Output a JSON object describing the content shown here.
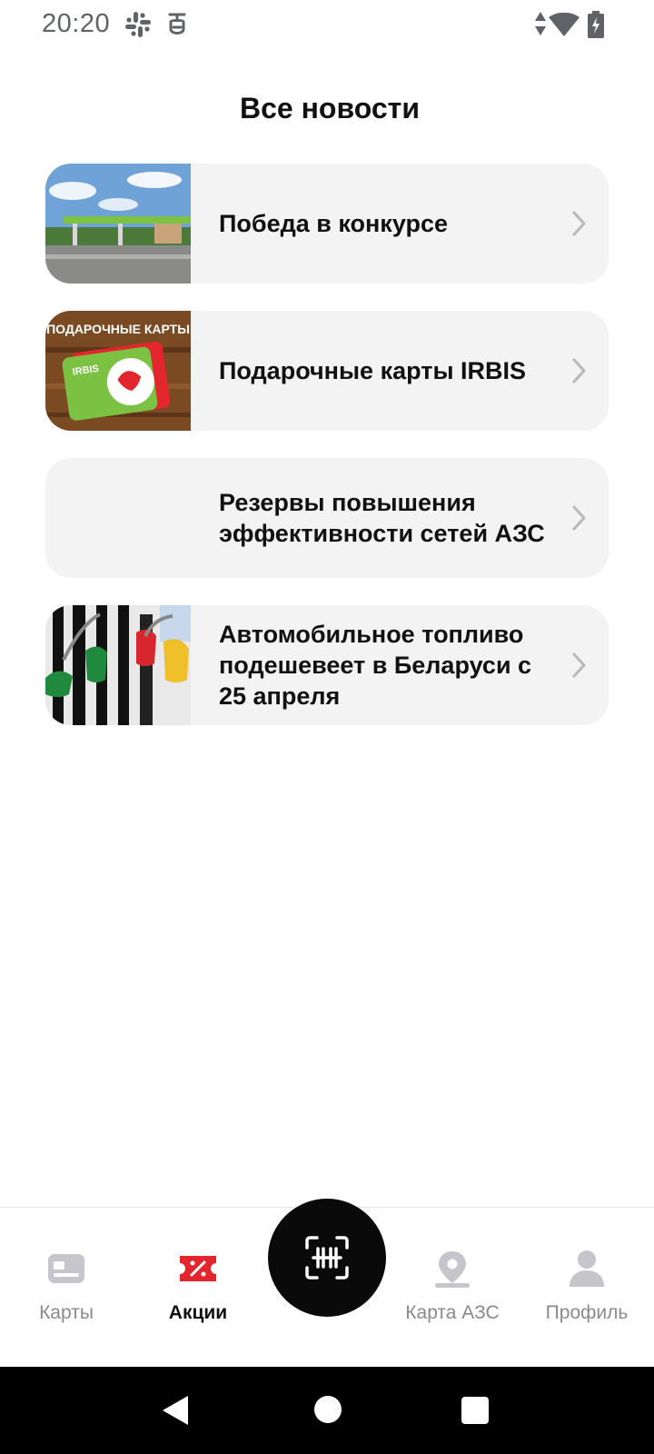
{
  "status_bar": {
    "time": "20:20",
    "icons": [
      "slack-icon",
      "notification-icon",
      "mobile-data-icon",
      "wifi-icon",
      "battery-charging-icon"
    ]
  },
  "header": {
    "title": "Все новости"
  },
  "news": [
    {
      "title": "Победа в конкурсе",
      "thumbnail": "gas-station-photo"
    },
    {
      "title": "Подарочные карты IRBIS",
      "thumbnail": "gift-cards-photo",
      "thumbnail_caption": "ПОДАРОЧНЫЕ КАРТЫ",
      "card_brand": "IRBIS"
    },
    {
      "title": "Резервы повышения эффективности сетей АЗС",
      "thumbnail": ""
    },
    {
      "title": "Автомобильное топливо подешевеет в Беларуси с 25 апреля",
      "thumbnail": "fuel-nozzles-photo"
    }
  ],
  "bottom_nav": {
    "items": [
      {
        "label": "Карты",
        "icon": "cards-icon",
        "active": false
      },
      {
        "label": "Акции",
        "icon": "promo-percent-icon",
        "active": true
      },
      {
        "label": "Карта АЗС",
        "icon": "map-pin-icon",
        "active": false
      },
      {
        "label": "Профиль",
        "icon": "profile-icon",
        "active": false
      }
    ],
    "center_button_icon": "barcode-scan-icon"
  },
  "colors": {
    "accent": "#e3262e",
    "card_background": "#f3f3f3",
    "inactive_nav": "#c5c5cb",
    "scan_button": "#0a0a0a"
  }
}
